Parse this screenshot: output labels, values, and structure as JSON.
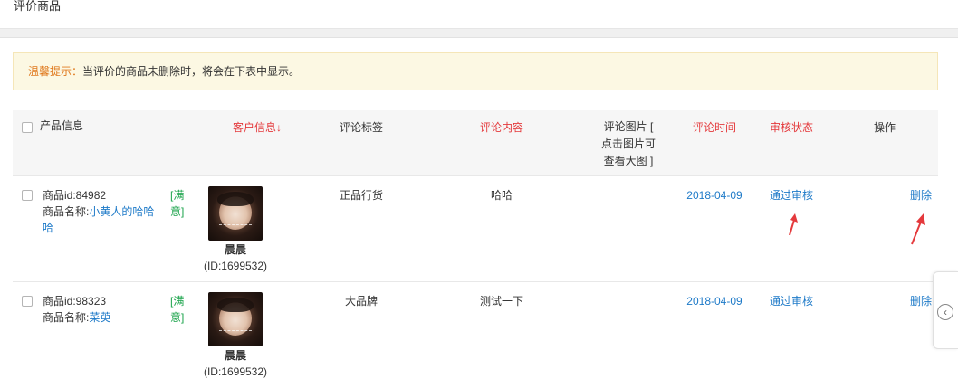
{
  "header": {
    "title": "评价商品"
  },
  "notice": {
    "label": "温馨提示：",
    "text": "当评价的商品未删除时，将会在下表中显示。"
  },
  "table": {
    "columns": {
      "product": "产品信息",
      "customer": "客户信息↓",
      "label": "评论标签",
      "content": "评论内容",
      "images_l1": "评论图片 [",
      "images_l2": "点击图片可",
      "images_l3": "查看大图 ]",
      "time": "评论时间",
      "status": "审核状态",
      "action": "操作"
    },
    "rows": [
      {
        "product_id": "商品id:84982",
        "product_name_prefix": "商品名称:",
        "product_name": "小黄人的哈哈哈",
        "rating_l1": "[满",
        "rating_l2": "意]",
        "user_name": "晨晨",
        "user_id": "(ID:1699532)",
        "label": "正品行货",
        "content": "哈哈",
        "time": "2018-04-09",
        "status": "通过审核",
        "action": "删除"
      },
      {
        "product_id": "商品id:98323",
        "product_name_prefix": "商品名称:",
        "product_name": "菜萸",
        "rating_l1": "[满",
        "rating_l2": "意]",
        "user_name": "晨晨",
        "user_id": "(ID:1699532)",
        "label": "大品牌",
        "content": "测试一下",
        "time": "2018-04-09",
        "status": "通过审核",
        "action": "删除"
      }
    ]
  },
  "colors": {
    "red": "#e4393c",
    "link": "#1e7ac8",
    "green": "#1aa34a",
    "notice_bg": "#fcf8e3",
    "notice_label": "#e07a1f"
  },
  "icons": {
    "side_handle": "chevron-left-circle-icon",
    "annotation": "red-arrow-icon"
  }
}
